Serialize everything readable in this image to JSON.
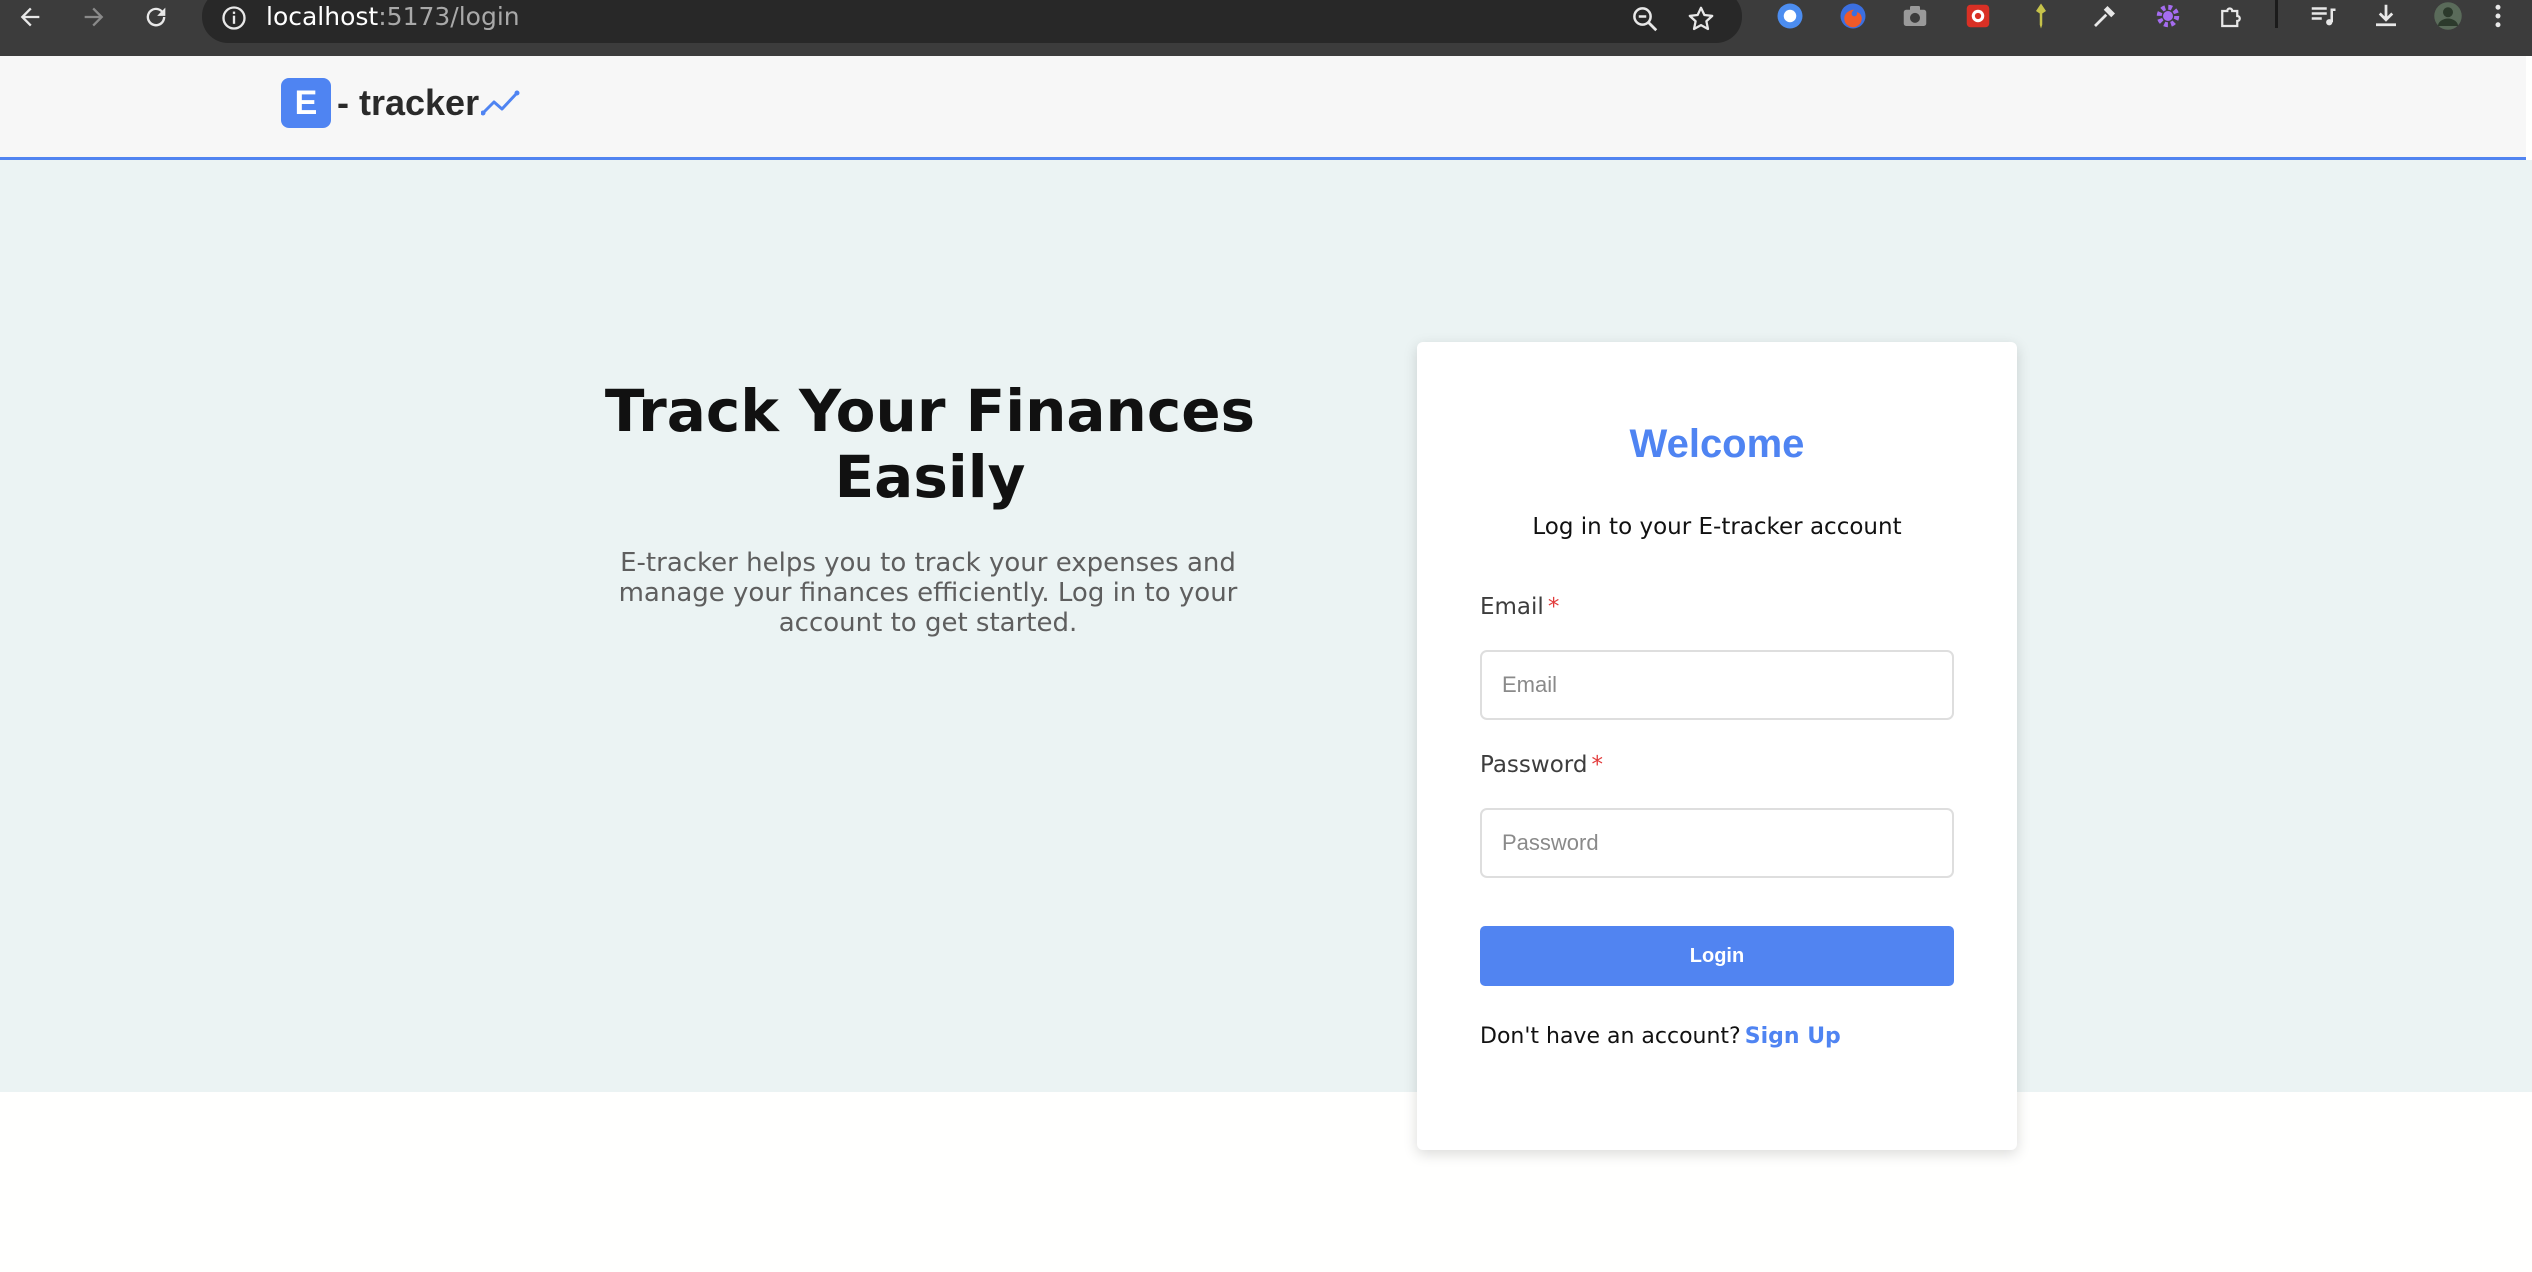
{
  "browser": {
    "url_host": "localhost",
    "url_path": ":5173/login",
    "icons": {
      "back": "arrow-left-icon",
      "forward": "arrow-right-icon",
      "reload": "reload-icon",
      "site_info": "info-icon",
      "zoom": "zoom-out-icon",
      "bookmark": "star-icon",
      "extensions": "puzzle-icon",
      "media": "media-playlist-icon",
      "downloads": "download-icon",
      "menu": "kebab-menu-icon"
    }
  },
  "navbar": {
    "logo_letter": "E",
    "logo_text": "- tracker"
  },
  "hero": {
    "title": "Track Your Finances Easily",
    "description": "E-tracker helps you to track your expenses and manage your finances efficiently. Log in to your account to get started."
  },
  "login": {
    "title": "Welcome",
    "subtitle": "Log in to your E-tracker account",
    "email_label": "Email",
    "email_placeholder": "Email",
    "password_label": "Password",
    "password_placeholder": "Password",
    "required_mark": "*",
    "button_label": "Login",
    "signup_prompt": "Don't have an account?",
    "signup_link": "Sign Up"
  },
  "colors": {
    "accent": "#5184f1",
    "hero_bg": "#ebf3f3",
    "required": "#e23b3b"
  }
}
